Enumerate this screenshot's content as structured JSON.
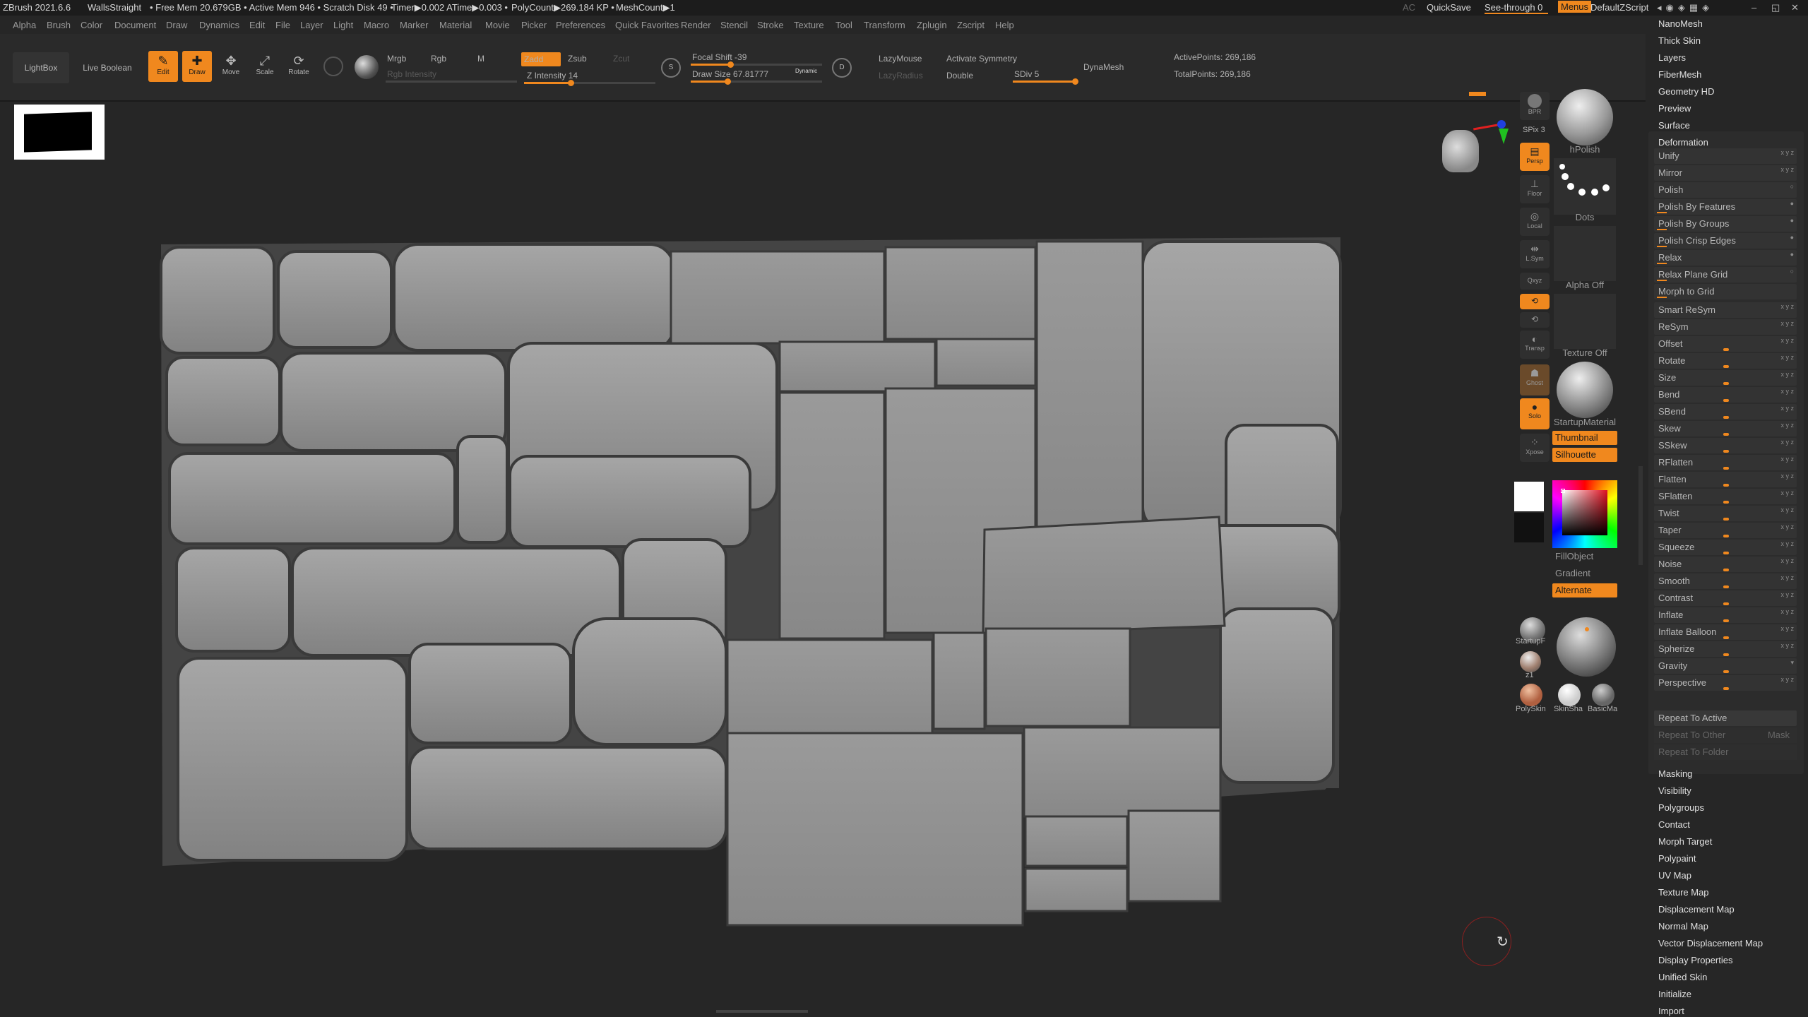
{
  "titlebar": {
    "app": "ZBrush 2021.6.6",
    "doc": "WallsStraight",
    "stats": "• Free Mem 20.679GB • Active Mem 946 • Scratch Disk 49 •",
    "timer": "Timer▶0.002 ATime▶0.003 •",
    "polycount": "PolyCount▶269.184 KP •",
    "meshcount": "MeshCount▶1",
    "ac": "AC",
    "quicksave": "QuickSave",
    "seethrough": "See-through  0",
    "menus": "Menus",
    "script": "DefaultZScript"
  },
  "menu": [
    "Alpha",
    "Brush",
    "Color",
    "Document",
    "Draw",
    "Dynamics",
    "Edit",
    "File",
    "Layer",
    "Light",
    "Macro",
    "Marker",
    "Material",
    "Movie",
    "Picker",
    "Preferences",
    "Quick Favorites",
    "Render",
    "Stencil",
    "Stroke",
    "Texture",
    "Tool",
    "Transform",
    "Zplugin",
    "Zscript",
    "Help"
  ],
  "toolbar": {
    "lightbox": "LightBox",
    "live_boolean": "Live Boolean",
    "edit": "Edit",
    "draw": "Draw",
    "move": "Move",
    "scale": "Scale",
    "rotate": "Rotate",
    "mrgb": "Mrgb",
    "rgb": "Rgb",
    "m": "M",
    "rgb_intensity": "Rgb Intensity",
    "zadd": "Zadd",
    "zsub": "Zsub",
    "zcut": "Zcut",
    "z_intensity": "Z Intensity 14",
    "focal_shift": "Focal Shift -39",
    "draw_size": "Draw Size 67.81777",
    "dynamic": "Dynamic",
    "lazymouse": "LazyMouse",
    "lazyradius": "LazyRadius",
    "activate_symmetry": "Activate Symmetry",
    "double": "Double",
    "sdiv": "SDiv 5",
    "dynamesh": "DynaMesh",
    "active_points": "ActivePoints: 269,186",
    "total_points": "TotalPoints: 269,186"
  },
  "shelf": {
    "bpr": "BPR",
    "spix": "SPix 3",
    "persp": "Persp",
    "floor": "Floor",
    "local": "Local",
    "lsym": "L.Sym",
    "xyz": "Qxyz",
    "transp": "Transp",
    "ghost": "Ghost",
    "solo": "Solo",
    "xpose": "Xpose"
  },
  "materials": {
    "hpolish": "hPolish",
    "dots": "Dots",
    "alpha_off": "Alpha Off",
    "texture_off": "Texture Off",
    "startup_material": "StartupMaterial",
    "thumbnail": "Thumbnail",
    "silhouette": "Silhouette",
    "fillobject": "FillObject",
    "gradient": "Gradient",
    "alternate": "Alternate",
    "startup": "StartupF",
    "z1": "z1",
    "polyskin": "PolySkin",
    "skinsha": "SkinSha",
    "basicma": "BasicMa"
  },
  "right_panel": {
    "top_items": [
      "NanoMesh",
      "Thick Skin",
      "Layers",
      "FiberMesh",
      "Geometry HD",
      "Preview",
      "Surface"
    ],
    "deformation": "Deformation",
    "deform_items": [
      "Unify",
      "Mirror",
      "Polish",
      "Polish By Features",
      "Polish By Groups",
      "Polish Crisp Edges",
      "Relax",
      "Relax Plane Grid",
      "Morph to Grid",
      "Smart ReSym",
      "ReSym",
      "Offset",
      "Rotate",
      "Size",
      "Bend",
      "SBend",
      "Skew",
      "SSkew",
      "RFlatten",
      "Flatten",
      "SFlatten",
      "Twist",
      "Taper",
      "Squeeze",
      "Noise",
      "Smooth",
      "Contrast",
      "Inflate",
      "Inflate Balloon",
      "Spherize",
      "Gravity",
      "Perspective"
    ],
    "repeat_active": "Repeat To Active",
    "repeat_other": "Repeat To Other",
    "mask": "Mask",
    "repeat_folder": "Repeat To Folder",
    "bottom_items": [
      "Masking",
      "Visibility",
      "Polygroups",
      "Contact",
      "Morph Target",
      "Polypaint",
      "UV Map",
      "Texture Map",
      "Displacement Map",
      "Normal Map",
      "Vector Displacement Map",
      "Display Properties",
      "Unified Skin",
      "Initialize",
      "Import"
    ]
  },
  "colors": {
    "accent": "#f0881e",
    "background": "#262626",
    "mesh": "#8c8c8c"
  }
}
